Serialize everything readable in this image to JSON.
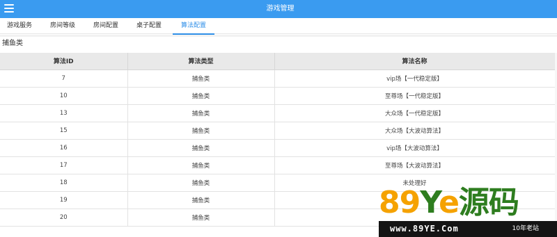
{
  "header": {
    "title": "游戏管理"
  },
  "tabs": [
    {
      "label": "游戏服务"
    },
    {
      "label": "房间等级"
    },
    {
      "label": "房间配置"
    },
    {
      "label": "桌子配置"
    },
    {
      "label": "算法配置"
    }
  ],
  "active_tab": "算法配置",
  "category_label": "捕鱼类",
  "table": {
    "columns": [
      "算法ID",
      "算法类型",
      "算法名称"
    ],
    "rows": [
      {
        "id": "7",
        "type": "捕鱼类",
        "name": "vip场【一代稳定版】"
      },
      {
        "id": "10",
        "type": "捕鱼类",
        "name": "至尊场【一代稳定版】"
      },
      {
        "id": "13",
        "type": "捕鱼类",
        "name": "大众场【一代稳定版】"
      },
      {
        "id": "15",
        "type": "捕鱼类",
        "name": "大众场【大波动算法】"
      },
      {
        "id": "16",
        "type": "捕鱼类",
        "name": "vip场【大波动算法】"
      },
      {
        "id": "17",
        "type": "捕鱼类",
        "name": "至尊场【大波动算法】"
      },
      {
        "id": "18",
        "type": "捕鱼类",
        "name": "未处理好"
      },
      {
        "id": "19",
        "type": "捕鱼类",
        "name": ""
      },
      {
        "id": "20",
        "type": "捕鱼类",
        "name": ""
      }
    ]
  },
  "watermark": {
    "logo_digits": "89",
    "logo_y": "Y",
    "logo_e": "e",
    "logo_cn": "源码",
    "url": "www.89YE.Com",
    "slogan": "10年老站"
  },
  "colors": {
    "header_bg": "#3a9bf0",
    "active_tab": "#2f8fe8",
    "table_header_bg": "#e9e9e9"
  }
}
